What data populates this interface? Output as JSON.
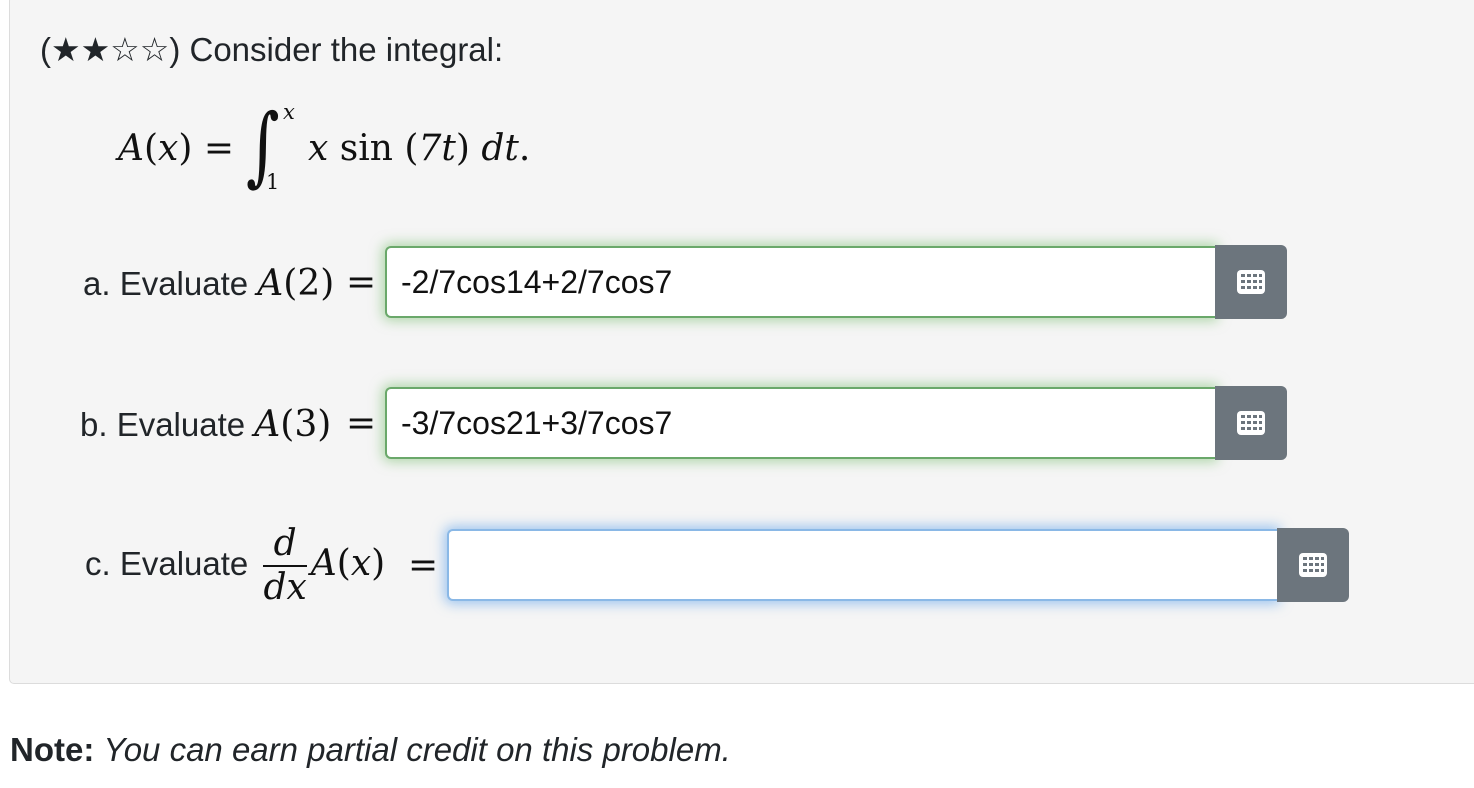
{
  "problem": {
    "intro": "(★★☆☆) Consider the integral:",
    "equation": {
      "lhs_func": "A",
      "lhs_var": "x",
      "lower_limit": "1",
      "upper_limit": "x",
      "integrand_var": "x",
      "integrand_fn": "sin",
      "integrand_arg": "7t",
      "differential": "dt"
    },
    "parts": [
      {
        "label": "a. Evaluate",
        "func": "A",
        "arg": "2",
        "value": "-2/7cos14+2/7cos7",
        "status": "correct"
      },
      {
        "label": "b. Evaluate",
        "func": "A",
        "arg": "3",
        "value": "-3/7cos21+3/7cos7",
        "status": "correct"
      },
      {
        "label": "c. Evaluate",
        "frac_num": "d",
        "frac_den": "dx",
        "func": "A",
        "arg": "x",
        "value": "",
        "status": "focused"
      }
    ]
  },
  "note": {
    "label": "Note:",
    "text": "You can earn partial credit on this problem."
  },
  "icons": {
    "input_helper": "grid-icon"
  },
  "colors": {
    "correct_glow": "#6aa86a",
    "focus_glow": "#8ab8e6",
    "button_bg": "#6c757d",
    "panel_bg": "#f5f5f5"
  }
}
